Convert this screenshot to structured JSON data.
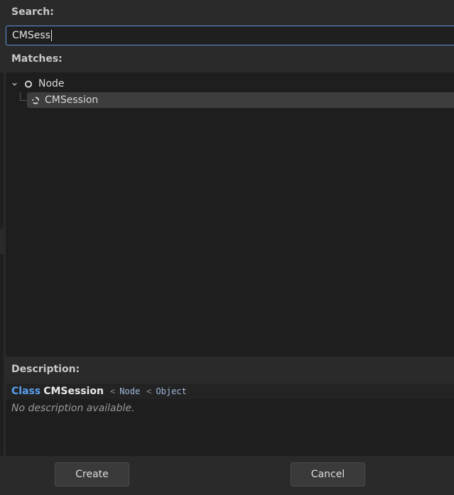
{
  "labels": {
    "search": "Search:",
    "matches": "Matches:",
    "description": "Description:"
  },
  "search": {
    "value": "CMSess"
  },
  "tree": {
    "root": {
      "label": "Node",
      "icon": "node-circle-icon",
      "expanded": true
    },
    "children": [
      {
        "label": "CMSession",
        "icon": "cmsession-spinner-icon",
        "selected": true
      }
    ]
  },
  "description": {
    "keyword": "Class",
    "class_name": "CMSession",
    "lt1": "<",
    "parent1": "Node",
    "lt2": "<",
    "parent2": "Object",
    "text": "No description available."
  },
  "buttons": {
    "create": "Create",
    "cancel": "Cancel"
  },
  "colors": {
    "accent": "#5a95d8",
    "class_keyword": "#58a0f0",
    "background": "#2a2a2a",
    "panel": "#1e1e1e",
    "selected_row": "#3d3d3d"
  }
}
